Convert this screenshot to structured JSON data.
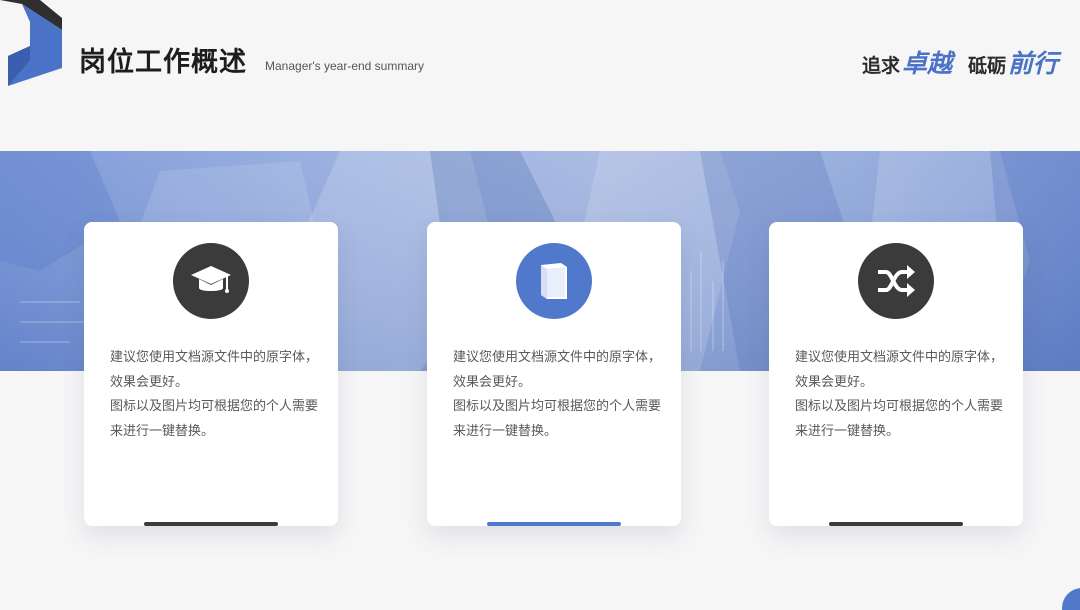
{
  "header": {
    "title": "岗位工作概述",
    "subtitle": "Manager's year-end summary",
    "slogan": {
      "part1_plain": "追求",
      "part1_accent": "卓越",
      "part2_plain": "砥砺",
      "part2_accent": "前行"
    }
  },
  "colors": {
    "accent": "#4a72c6",
    "dark": "#3b3b3b",
    "background": "#f6f6f7"
  },
  "cards": [
    {
      "icon": "graduation-cap-icon",
      "line1": "建议您使用文档源文件中的原字体，效果会更好。",
      "line2": "图标以及图片均可根据您的个人需要来进行一键替换。"
    },
    {
      "icon": "book-icon",
      "line1": "建议您使用文档源文件中的原字体，效果会更好。",
      "line2": "图标以及图片均可根据您的个人需要来进行一键替换。"
    },
    {
      "icon": "shuffle-icon",
      "line1": "建议您使用文档源文件中的原字体，效果会更好。",
      "line2": "图标以及图片均可根据您的个人需要来进行一键替换。"
    }
  ]
}
